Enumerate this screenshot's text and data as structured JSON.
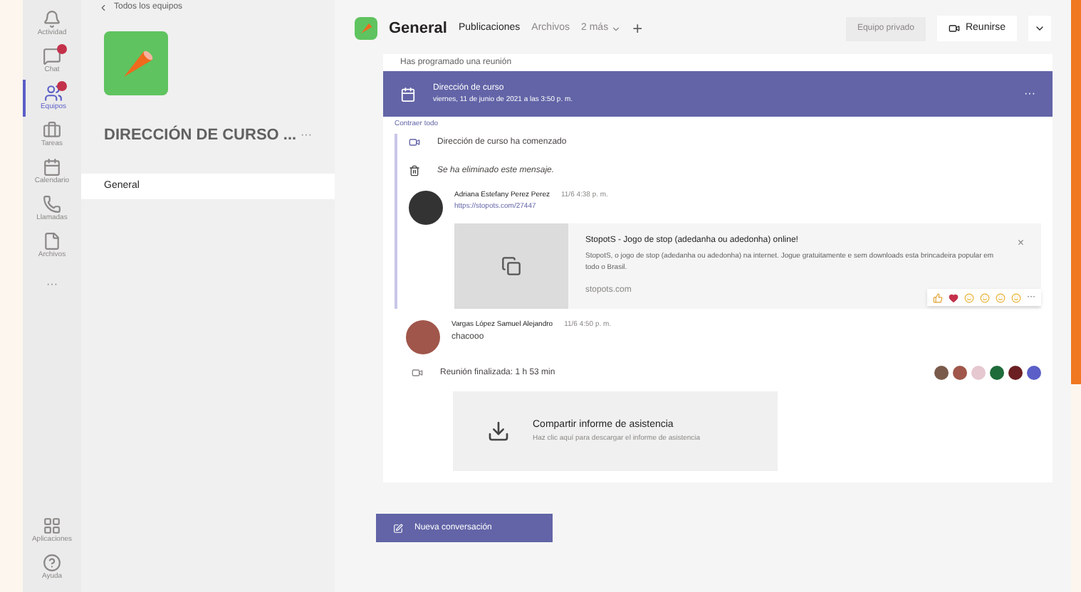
{
  "rail": {
    "items": [
      {
        "label": "Actividad",
        "kind": "bell",
        "badge": false,
        "selected": false
      },
      {
        "label": "Chat",
        "kind": "chat",
        "badge": true,
        "selected": false
      },
      {
        "label": "Equipos",
        "kind": "teams",
        "badge": true,
        "selected": true
      },
      {
        "label": "Tareas",
        "kind": "bag",
        "badge": false,
        "selected": false
      },
      {
        "label": "Calendario",
        "kind": "calendar",
        "badge": false,
        "selected": false
      },
      {
        "label": "Llamadas",
        "kind": "phone",
        "badge": false,
        "selected": false
      },
      {
        "label": "Archivos",
        "kind": "file",
        "badge": false,
        "selected": false
      }
    ],
    "more": "···",
    "bottom": [
      {
        "label": "Aplicaciones",
        "kind": "apps"
      },
      {
        "label": "Ayuda",
        "kind": "help"
      }
    ]
  },
  "sidebar": {
    "back": "Todos los equipos",
    "team_name": "DIRECCIÓN DE CURSO ...",
    "team_more": "···",
    "channels": [
      {
        "label": "General",
        "selected": true
      }
    ]
  },
  "header": {
    "channel": "General",
    "tabs": [
      {
        "label": "Publicaciones",
        "selected": true
      },
      {
        "label": "Archivos",
        "selected": false
      },
      {
        "label": "2 más",
        "selected": false
      }
    ],
    "add": "+",
    "privacy": "Equipo privado",
    "meet_button": "Reunirse"
  },
  "thread": {
    "scheduled": "Has programado una reunión",
    "meeting": {
      "title": "Dirección de curso",
      "when": "viernes, 11 de junio de 2021 a las 3:50 p. m.",
      "more": "···"
    },
    "collapse": "Contraer todo",
    "events": [
      {
        "kind": "started",
        "text": "Dirección de curso ha comenzado"
      },
      {
        "kind": "deleted",
        "text": "Se ha eliminado este mensaje."
      }
    ],
    "post": {
      "author": "Adriana Estefany Perez Perez",
      "time": "11/6 4:38 p. m.",
      "link": "https://stopots.com/27447",
      "preview": {
        "title": "StopotS - Jogo de stop (adedanha ou adedonha) online!",
        "description": "StopotS, o jogo de stop (adedanha ou adedonha) na internet. Jogue gratuitamente e sem downloads esta brincadeira popular em todo o Brasil.",
        "domain": "stopots.com",
        "close": "×"
      },
      "reactions_more": "···"
    },
    "reply": {
      "author": "Vargas López Samuel Alejandro",
      "time": "11/6 4:50 p. m.",
      "text": "chacooo"
    },
    "ended": {
      "text": "Reunión finalizada: 1 h 53 min",
      "participants": [
        {
          "color": "#7a5a4a"
        },
        {
          "color": "#a0564a"
        },
        {
          "color": "#e6c8d0"
        },
        {
          "color": "#1f6b3a"
        },
        {
          "color": "#6b1f22"
        },
        {
          "color": "#5b5fc7"
        }
      ]
    },
    "attendance": {
      "title": "Compartir informe de asistencia",
      "description": "Haz clic aquí para descargar el informe de asistencia"
    }
  },
  "new_conversation": "Nueva conversación"
}
